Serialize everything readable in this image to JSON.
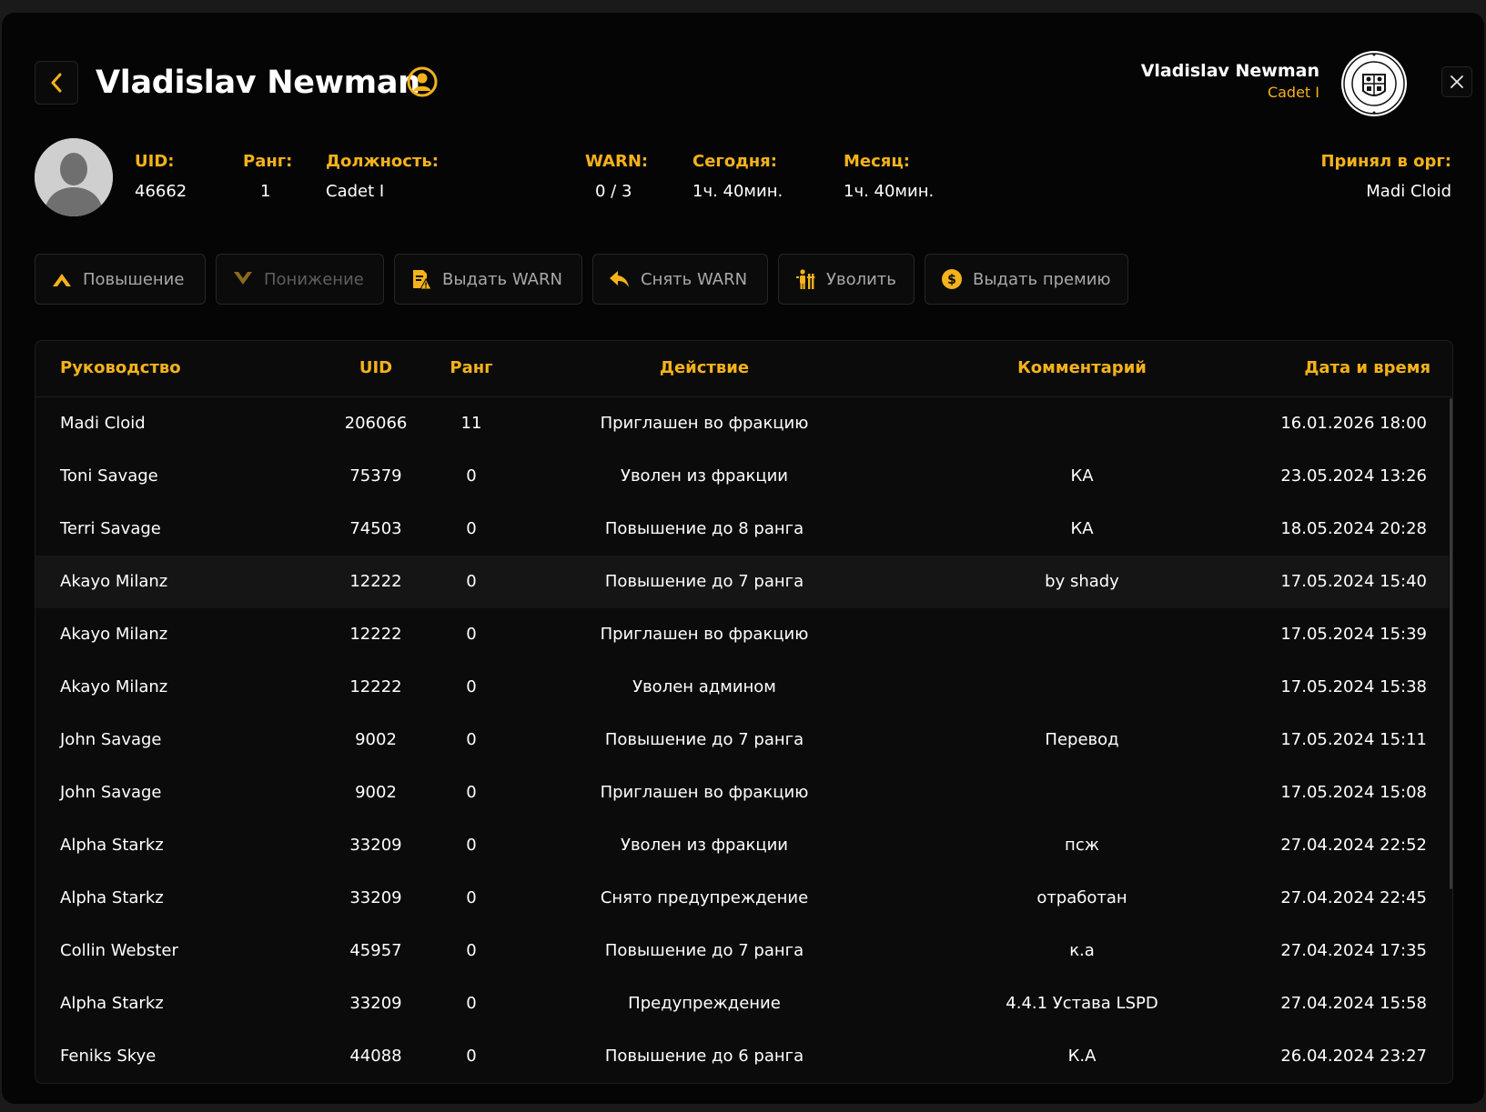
{
  "header": {
    "title": "Vladislav Newman",
    "user_name": "Vladislav Newman",
    "user_rank": "Cadet I"
  },
  "info": {
    "uid_label": "UID:",
    "uid_value": "46662",
    "rank_label": "Ранг:",
    "rank_value": "1",
    "position_label": "Должность:",
    "position_value": "Cadet I",
    "warn_label": "WARN:",
    "warn_value": "0 / 3",
    "today_label": "Сегодня:",
    "today_value": "1ч. 40мин.",
    "month_label": "Месяц:",
    "month_value": "1ч. 40мин.",
    "hired_label": "Принял в орг:",
    "hired_value": "Madi Cloid"
  },
  "actions": {
    "promote": "Повышение",
    "demote": "Понижение",
    "give_warn": "Выдать WARN",
    "remove_warn": "Снять WARN",
    "fire": "Уволить",
    "bonus": "Выдать премию"
  },
  "table": {
    "headers": {
      "name": "Руководство",
      "uid": "UID",
      "rank": "Ранг",
      "action": "Действие",
      "comment": "Комментарий",
      "date": "Дата и время"
    },
    "rows": [
      {
        "name": "Madi Cloid",
        "uid": "206066",
        "rank": "11",
        "action": "Приглашен во фракцию",
        "comment": "",
        "date": "16.01.2026 18:00"
      },
      {
        "name": "Toni Savage",
        "uid": "75379",
        "rank": "0",
        "action": "Уволен из фракции",
        "comment": "КА",
        "date": "23.05.2024 13:26"
      },
      {
        "name": "Terri Savage",
        "uid": "74503",
        "rank": "0",
        "action": "Повышение до 8 ранга",
        "comment": "КА",
        "date": "18.05.2024 20:28"
      },
      {
        "name": "Akayo Milanz",
        "uid": "12222",
        "rank": "0",
        "action": "Повышение до 7 ранга",
        "comment": "by shady",
        "date": "17.05.2024 15:40"
      },
      {
        "name": "Akayo Milanz",
        "uid": "12222",
        "rank": "0",
        "action": "Приглашен во фракцию",
        "comment": "",
        "date": "17.05.2024 15:39"
      },
      {
        "name": "Akayo Milanz",
        "uid": "12222",
        "rank": "0",
        "action": "Уволен админом",
        "comment": "",
        "date": "17.05.2024 15:38"
      },
      {
        "name": "John Savage",
        "uid": "9002",
        "rank": "0",
        "action": "Повышение до 7 ранга",
        "comment": "Перевод",
        "date": "17.05.2024 15:11"
      },
      {
        "name": "John Savage",
        "uid": "9002",
        "rank": "0",
        "action": "Приглашен во фракцию",
        "comment": "",
        "date": "17.05.2024 15:08"
      },
      {
        "name": "Alpha Starkz",
        "uid": "33209",
        "rank": "0",
        "action": "Уволен из фракции",
        "comment": "псж",
        "date": "27.04.2024 22:52"
      },
      {
        "name": "Alpha Starkz",
        "uid": "33209",
        "rank": "0",
        "action": "Снято предупреждение",
        "comment": "отработан",
        "date": "27.04.2024 22:45"
      },
      {
        "name": "Collin Webster",
        "uid": "45957",
        "rank": "0",
        "action": "Повышение до 7 ранга",
        "comment": "к.а",
        "date": "27.04.2024 17:35"
      },
      {
        "name": "Alpha Starkz",
        "uid": "33209",
        "rank": "0",
        "action": "Предупреждение",
        "comment": "4.4.1 Устава LSPD",
        "date": "27.04.2024 15:58"
      },
      {
        "name": "Feniks Skye",
        "uid": "44088",
        "rank": "0",
        "action": "Повышение до 6 ранга",
        "comment": "К.А",
        "date": "26.04.2024 23:27"
      }
    ]
  },
  "icons": {
    "back": "chevron-left-icon",
    "title_badge": "user-badge-icon",
    "seal": "city-seal-logo",
    "close": "close-icon",
    "avatar": "avatar-placeholder"
  },
  "colors": {
    "accent": "#f5b21b",
    "background": "#050505",
    "panel": "#0b0b0b",
    "text": "#ffffff",
    "muted": "#a8a8a8"
  }
}
